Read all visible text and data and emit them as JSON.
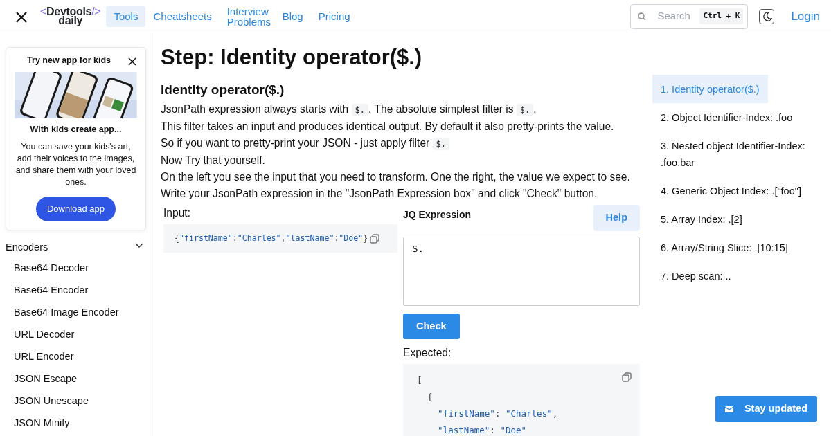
{
  "navbar": {
    "logo": {
      "open": "<",
      "name": "Devtools",
      "close": "/>",
      "sub": "daily"
    },
    "links": [
      {
        "label": "Tools",
        "selected": true
      },
      {
        "label": "Cheatsheets",
        "selected": false
      },
      {
        "label": "Interview Problems",
        "selected": false
      },
      {
        "label": "Blog",
        "selected": false
      },
      {
        "label": "Pricing",
        "selected": false
      }
    ],
    "search": {
      "placeholder": "Search",
      "shortcut": "Ctrl + K"
    },
    "login": "Login"
  },
  "promo": {
    "title": "Try new app for kids",
    "heading": "With kids create app...",
    "text": "You can save your kids's art, add their voices to the images, and share them with your loved ones.",
    "button": "Download app"
  },
  "sidebar": {
    "section": "Encoders",
    "expanded": true,
    "items": [
      "Base64 Decoder",
      "Base64 Encoder",
      "Base64 Image Encoder",
      "URL Decoder",
      "URL Encoder",
      "JSON Escape",
      "JSON Unescape",
      "JSON Minify"
    ]
  },
  "main": {
    "title": "Step: Identity operator($.)",
    "subtitle": "Identity operator($.)",
    "lines": [
      [
        {
          "kind": "text",
          "text": "JsonPath expression always starts with "
        },
        {
          "kind": "code",
          "text": "$."
        },
        {
          "kind": "text",
          "text": ". The absolute simplest filter is "
        },
        {
          "kind": "code",
          "text": "$."
        },
        {
          "kind": "text",
          "text": "."
        }
      ],
      [
        {
          "kind": "text",
          "text": "This filter takes an input and produces identical output. By default it also pretty-prints the value."
        }
      ],
      [
        {
          "kind": "text",
          "text": "So if you want to pretty-print your JSON - just apply filter "
        },
        {
          "kind": "code",
          "text": "$."
        }
      ],
      [
        {
          "kind": "text",
          "text": "Now Try that yourself."
        }
      ],
      [
        {
          "kind": "text",
          "text": "On the left you see the input that you need to transform. One the right, the value we expect to see."
        }
      ],
      [
        {
          "kind": "text",
          "text": "Write your JsonPath expression in the \"JsonPath Expression box\" and click \"Check\" button."
        }
      ]
    ],
    "input": {
      "label": "Input:",
      "code": "{\"firstName\":\"Charles\",\"lastName\":\"Doe\"}"
    },
    "expression": {
      "label": "JQ Expression",
      "help": "Help",
      "value": "$.",
      "check": "Check"
    },
    "expected": {
      "label": "Expected:",
      "lines": [
        "[",
        "  {",
        "    \"firstName\": \"Charles\",",
        "    \"lastName\": \"Doe\""
      ]
    }
  },
  "toc": [
    {
      "label": "1. Identity operator($.)",
      "selected": true
    },
    {
      "label": "2. Object Identifier-Index: .foo",
      "selected": false
    },
    {
      "label": "3. Nested object Identifier-Index: .foo.bar",
      "selected": false
    },
    {
      "label": "4. Generic Object Index: .[\"foo\"]",
      "selected": false
    },
    {
      "label": "5. Array Index: .[2]",
      "selected": false
    },
    {
      "label": "6. Array/String Slice: .[10:15]",
      "selected": false
    },
    {
      "label": "7. Deep scan: ..",
      "selected": false
    }
  ],
  "stay_updated": "Stay updated"
}
